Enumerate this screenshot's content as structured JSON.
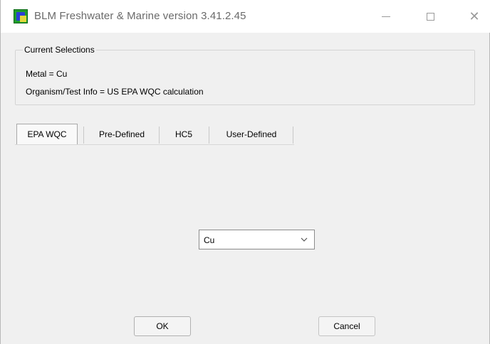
{
  "window": {
    "title": "BLM Freshwater & Marine version 3.41.2.45",
    "controls": {
      "minimize": "minimize-icon",
      "maximize": "maximize-icon",
      "close": "✕"
    }
  },
  "current_selections": {
    "heading": "Current Selections",
    "metal": "Metal = Cu",
    "organism": "Organism/Test Info = US EPA WQC calculation"
  },
  "tabs": [
    {
      "label": "EPA WQC",
      "active": true
    },
    {
      "label": "Pre-Defined",
      "active": false
    },
    {
      "label": "HC5",
      "active": false
    },
    {
      "label": "User-Defined",
      "active": false
    }
  ],
  "metal_select": {
    "value": "Cu",
    "icon": "chevron-down-icon"
  },
  "buttons": {
    "ok": "OK",
    "cancel": "Cancel"
  },
  "colors": {
    "app_icon_green": "#1f9d2b",
    "app_icon_blue": "#2b3fd6",
    "title_gray": "#6a6a6a"
  }
}
